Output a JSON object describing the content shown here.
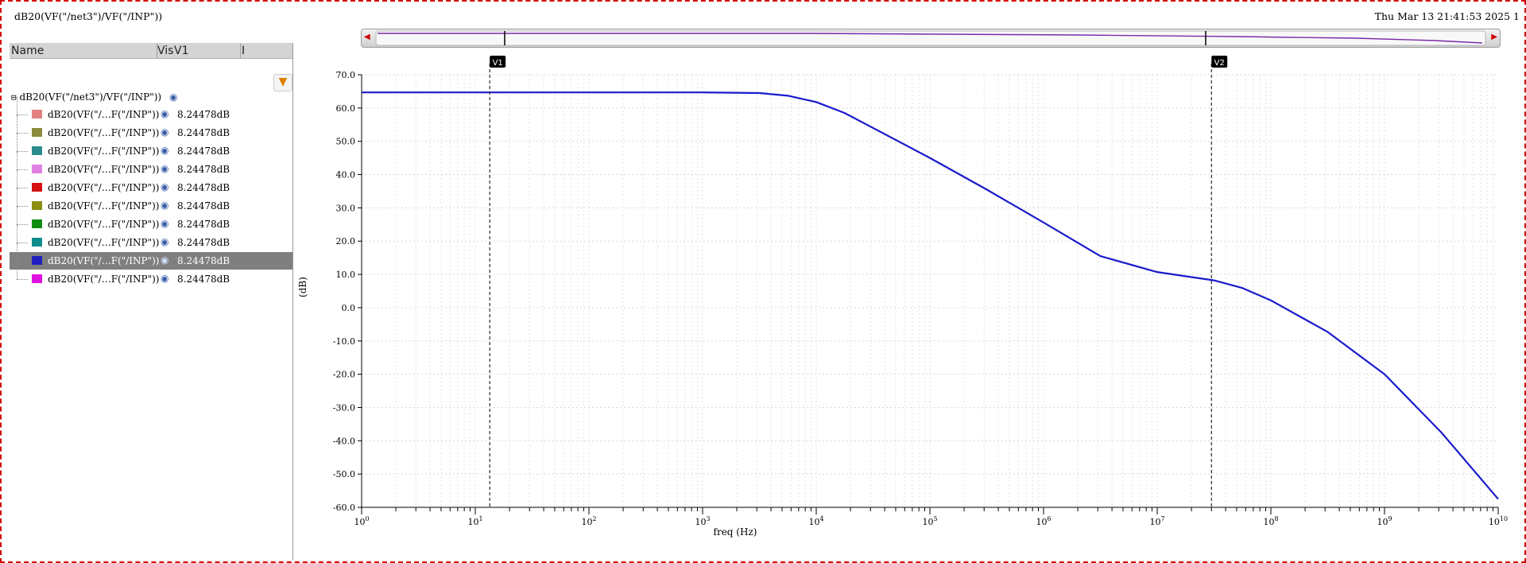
{
  "window": {
    "title": "dB20(VF(\"/net3\")/VF(\"/INP\"))",
    "datetime": "Thu Mar 13 21:41:53 2025  1"
  },
  "panel": {
    "columns": [
      "Name",
      "Vis",
      "V1",
      "I"
    ],
    "root_label": "dB20(VF(\"/net3\")/VF(\"/INP\"))",
    "rows": [
      {
        "label": "dB20(VF(\"/…F(\"/INP\"))",
        "value": "8.24478dB",
        "color": "#e08080"
      },
      {
        "label": "dB20(VF(\"/…F(\"/INP\"))",
        "value": "8.24478dB",
        "color": "#8c8c3c"
      },
      {
        "label": "dB20(VF(\"/…F(\"/INP\"))",
        "value": "8.24478dB",
        "color": "#2c8c8c"
      },
      {
        "label": "dB20(VF(\"/…F(\"/INP\"))",
        "value": "8.24478dB",
        "color": "#e080e0"
      },
      {
        "label": "dB20(VF(\"/…F(\"/INP\"))",
        "value": "8.24478dB",
        "color": "#d41010"
      },
      {
        "label": "dB20(VF(\"/…F(\"/INP\"))",
        "value": "8.24478dB",
        "color": "#8c8c10"
      },
      {
        "label": "dB20(VF(\"/…F(\"/INP\"))",
        "value": "8.24478dB",
        "color": "#108c10"
      },
      {
        "label": "dB20(VF(\"/…F(\"/INP\"))",
        "value": "8.24478dB",
        "color": "#108c8c"
      },
      {
        "label": "dB20(VF(\"/…F(\"/INP\"))",
        "value": "8.24478dB",
        "color": "#2020c0",
        "selected": true
      },
      {
        "label": "dB20(VF(\"/…F(\"/INP\"))",
        "value": "8.24478dB",
        "color": "#e010e0"
      }
    ]
  },
  "chart_data": {
    "type": "line",
    "xlabel": "freq (Hz)",
    "ylabel": "(dB)",
    "x_scale": "log",
    "xlim": [
      1,
      10000000000
    ],
    "ylim": [
      -60,
      70
    ],
    "yticks": [
      70,
      60,
      50,
      40,
      30,
      20,
      10,
      0,
      -10,
      -20,
      -30,
      -40,
      -50,
      -60
    ],
    "ytick_labels": [
      "70.0",
      "60.0",
      "50.0",
      "40.0",
      "30.0",
      "20.0",
      "10.0",
      "0.0",
      "-10.0",
      "-20.0",
      "-30.0",
      "-40.0",
      "-50.0",
      "-60.0"
    ],
    "xticks": [
      1,
      10,
      100,
      1000,
      10000,
      100000,
      1000000,
      10000000,
      100000000,
      1000000000,
      10000000000
    ],
    "xtick_base": [
      "10",
      "10",
      "10",
      "10",
      "10",
      "10",
      "10",
      "10",
      "10",
      "10",
      "10"
    ],
    "xtick_exp": [
      "0",
      "1",
      "2",
      "3",
      "4",
      "5",
      "6",
      "7",
      "8",
      "9",
      "10"
    ],
    "grid": true,
    "series": [
      {
        "color": "#1a1acc",
        "x": [
          1,
          100,
          1000,
          3162,
          5623,
          10000,
          17783,
          31623,
          100000,
          316228,
          1000000,
          3162278,
          10000000,
          31622777,
          56234133,
          100000000,
          316227766,
          1000000000,
          3162277660,
          10000000000
        ],
        "y": [
          64.7,
          64.7,
          64.7,
          64.5,
          63.7,
          61.8,
          58.5,
          54.0,
          45.0,
          35.5,
          25.6,
          15.5,
          10.7,
          8.2,
          5.9,
          2.2,
          -7.3,
          -20.0,
          -37.5,
          -57.5
        ]
      }
    ],
    "cursors": [
      {
        "label": "V1",
        "x": 13.4
      },
      {
        "label": "V2",
        "x": 30000000
      }
    ]
  }
}
